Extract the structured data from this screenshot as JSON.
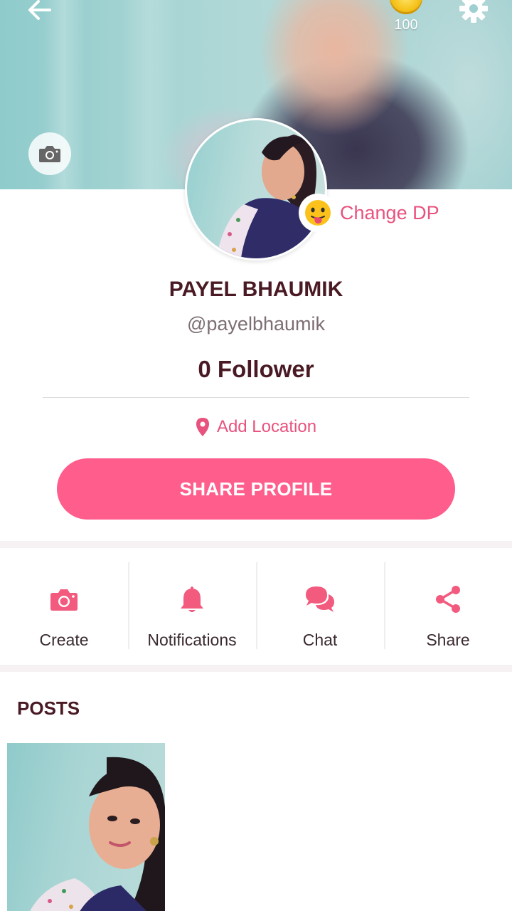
{
  "header": {
    "coin_count": "100"
  },
  "profile": {
    "change_dp_label": "Change DP",
    "name": "PAYEL BHAUMIK",
    "username": "@payelbhaumik",
    "followers": "0 Follower",
    "location_label": "Add Location",
    "share_button_label": "SHARE PROFILE"
  },
  "actions": [
    {
      "label": "Create",
      "icon": "camera-icon"
    },
    {
      "label": "Notifications",
      "icon": "bell-icon"
    },
    {
      "label": "Chat",
      "icon": "chat-bubbles-icon"
    },
    {
      "label": "Share",
      "icon": "share-icon"
    }
  ],
  "posts": {
    "title": "POSTS"
  },
  "colors": {
    "accent": "#ff5d8c",
    "accent_text": "#e8527e",
    "title_text": "#4a1a24",
    "muted_text": "#7d6e72"
  }
}
